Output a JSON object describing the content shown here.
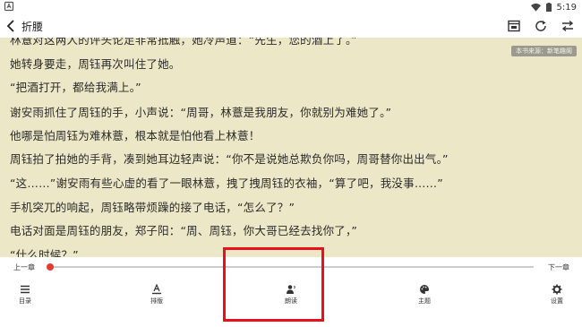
{
  "status": {
    "time": "5:19"
  },
  "header": {
    "title": "折腰"
  },
  "reader": {
    "source_badge": "本书来源：新笔趣阁",
    "paragraphs": [
      "林薏对这两人的评头论足非常抵触，她冷声道：“先生，您的酒上了。”",
      "她转身要走，周钰再次叫住了她。",
      "“把酒打开，都给我满上。”",
      "谢安雨抓住了周钰的手，小声说：“周哥，林薏是我朋友，你就别为难她了。”",
      "他哪是怕周钰为难林薏，根本就是怕他看上林薏！",
      "周钰拍了拍她的手背，凑到她耳边轻声说：“你不是说她总欺负你吗，周哥替你出出气。”",
      "“这……”谢安雨有些心虚的看了一眼林薏，拽了拽周钰的衣袖，“算了吧，我没事……”",
      "手机突兀的响起，周钰略带烦躁的接了电话，“怎么了？”",
      "电话对面是周钰的朋友，郑子阳：“周、周钰，你大哥已经去找你了，”",
      "“什么时候？”"
    ]
  },
  "controls": {
    "prev_chapter": "上一章",
    "next_chapter": "下一章",
    "progress": 0,
    "accent_color": "#e53935"
  },
  "bottom_nav": {
    "items": [
      {
        "label": "目录",
        "icon": "menu-icon"
      },
      {
        "label": "排版",
        "icon": "text-format-icon"
      },
      {
        "label": "朗读",
        "icon": "read-aloud-icon"
      },
      {
        "label": "主题",
        "icon": "palette-icon"
      },
      {
        "label": "设置",
        "icon": "settings-gear-icon"
      }
    ]
  },
  "annotation": {
    "highlight_color": "#e8101a"
  }
}
